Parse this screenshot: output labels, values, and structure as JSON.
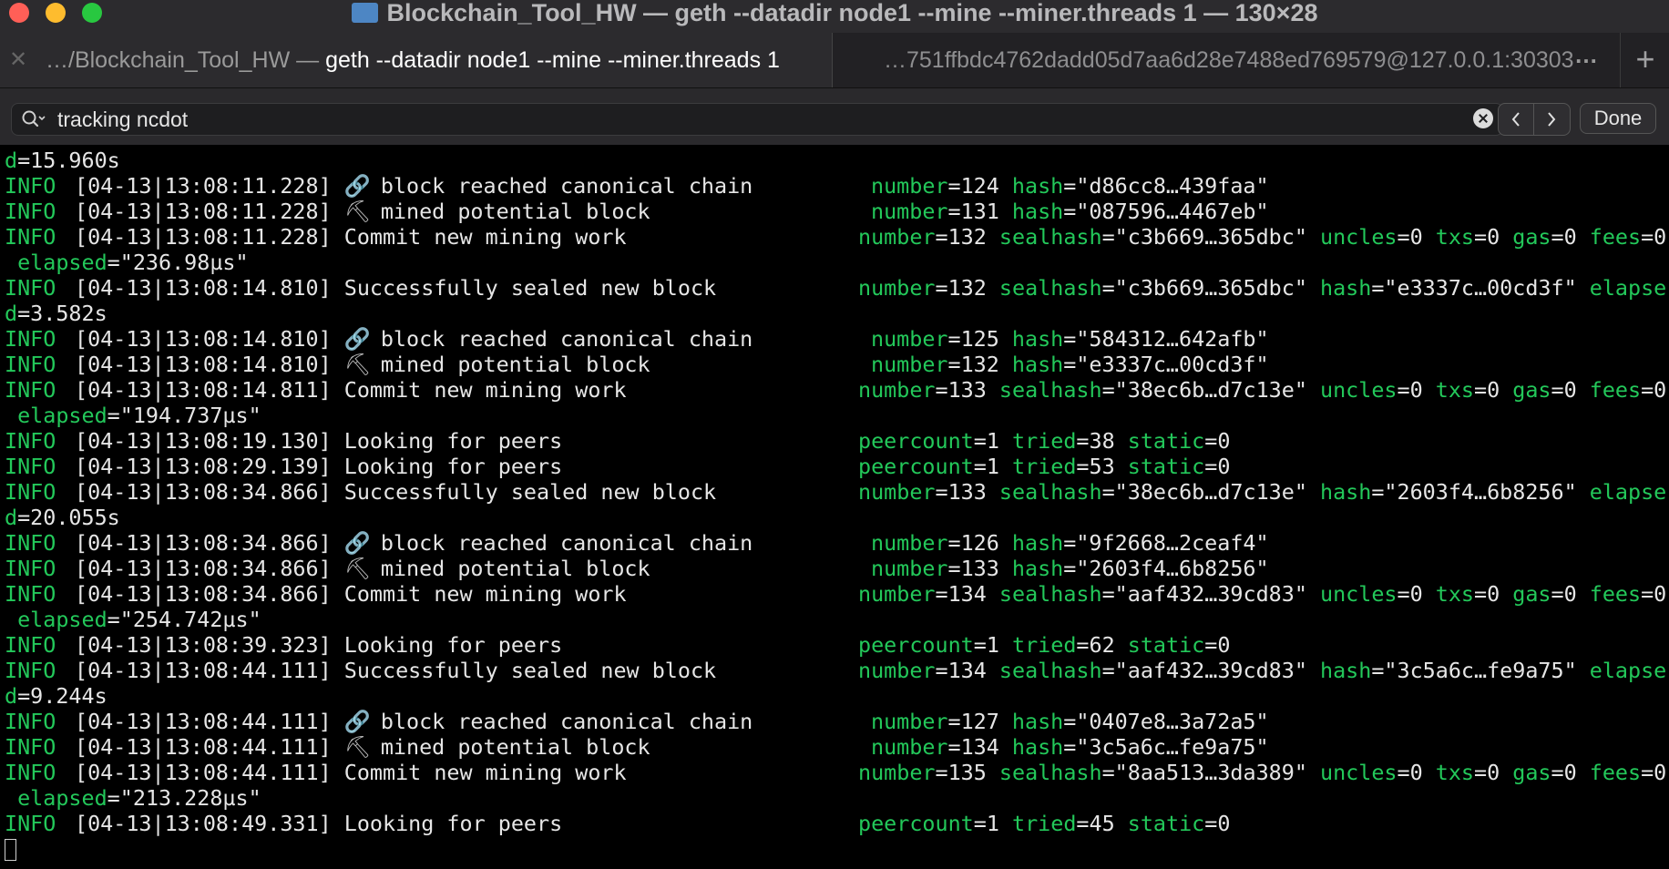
{
  "window": {
    "title": "Blockchain_Tool_HW — geth --datadir node1 --mine --miner.threads 1 — 130×28"
  },
  "tabs": [
    {
      "prefix": "…/Blockchain_Tool_HW — ",
      "label": "geth --datadir node1 --mine --miner.threads 1"
    },
    {
      "label": "…751ffbdc4762dadd05d7aa6d28e7488ed769579@127.0.0.1:30303"
    }
  ],
  "tab_more": "…",
  "tab_add": "+",
  "find": {
    "query": "tracking ncdot",
    "done_label": "Done"
  },
  "icons": {
    "chain": "🔗",
    "hammer": "⛏",
    "search": "search-icon",
    "clear": "clear-icon"
  },
  "log_lines": [
    {
      "type": "cont",
      "parts": [
        [
          "k",
          "d"
        ],
        [
          "t",
          "=15.960s"
        ]
      ]
    },
    {
      "type": "log",
      "level": "INFO",
      "time": "[04-13|13:08:11.228]",
      "icon": "chain",
      "message": "block reached canonical chain",
      "indent": true,
      "fields": [
        [
          "number",
          "=124 "
        ],
        [
          "hash",
          "=\"d86cc8…439faa\""
        ]
      ]
    },
    {
      "type": "log",
      "level": "INFO",
      "time": "[04-13|13:08:11.228]",
      "icon": "hammer",
      "message": "mined potential block",
      "indent": true,
      "fields": [
        [
          "number",
          "=131 "
        ],
        [
          "hash",
          "=\"087596…4467eb\""
        ]
      ]
    },
    {
      "type": "log",
      "level": "INFO",
      "time": "[04-13|13:08:11.228]",
      "message": "Commit new mining work",
      "fields": [
        [
          "number",
          "=132 "
        ],
        [
          "sealhash",
          "=\"c3b669…365dbc\" "
        ],
        [
          "uncles",
          "=0 "
        ],
        [
          "txs",
          "=0 "
        ],
        [
          "gas",
          "=0 "
        ],
        [
          "fees",
          "=0"
        ]
      ]
    },
    {
      "type": "cont",
      "parts": [
        [
          "t",
          " "
        ],
        [
          "k",
          "elapsed"
        ],
        [
          "t",
          "=\"236.98µs\""
        ]
      ]
    },
    {
      "type": "log",
      "level": "INFO",
      "time": "[04-13|13:08:14.810]",
      "message": "Successfully sealed new block",
      "fields": [
        [
          "number",
          "=132 "
        ],
        [
          "sealhash",
          "=\"c3b669…365dbc\" "
        ],
        [
          "hash",
          "=\"e3337c…00cd3f\" "
        ],
        [
          "elapse",
          ""
        ]
      ]
    },
    {
      "type": "cont",
      "parts": [
        [
          "k",
          "d"
        ],
        [
          "t",
          "=3.582s"
        ]
      ]
    },
    {
      "type": "log",
      "level": "INFO",
      "time": "[04-13|13:08:14.810]",
      "icon": "chain",
      "message": "block reached canonical chain",
      "indent": true,
      "fields": [
        [
          "number",
          "=125 "
        ],
        [
          "hash",
          "=\"584312…642afb\""
        ]
      ]
    },
    {
      "type": "log",
      "level": "INFO",
      "time": "[04-13|13:08:14.810]",
      "icon": "hammer",
      "message": "mined potential block",
      "indent": true,
      "fields": [
        [
          "number",
          "=132 "
        ],
        [
          "hash",
          "=\"e3337c…00cd3f\""
        ]
      ]
    },
    {
      "type": "log",
      "level": "INFO",
      "time": "[04-13|13:08:14.811]",
      "message": "Commit new mining work",
      "fields": [
        [
          "number",
          "=133 "
        ],
        [
          "sealhash",
          "=\"38ec6b…d7c13e\" "
        ],
        [
          "uncles",
          "=0 "
        ],
        [
          "txs",
          "=0 "
        ],
        [
          "gas",
          "=0 "
        ],
        [
          "fees",
          "=0"
        ]
      ]
    },
    {
      "type": "cont",
      "parts": [
        [
          "t",
          " "
        ],
        [
          "k",
          "elapsed"
        ],
        [
          "t",
          "=\"194.737µs\""
        ]
      ]
    },
    {
      "type": "log",
      "level": "INFO",
      "time": "[04-13|13:08:19.130]",
      "message": "Looking for peers",
      "fields": [
        [
          "peercount",
          "=1 "
        ],
        [
          "tried",
          "=38 "
        ],
        [
          "static",
          "=0"
        ]
      ]
    },
    {
      "type": "log",
      "level": "INFO",
      "time": "[04-13|13:08:29.139]",
      "message": "Looking for peers",
      "fields": [
        [
          "peercount",
          "=1 "
        ],
        [
          "tried",
          "=53 "
        ],
        [
          "static",
          "=0"
        ]
      ]
    },
    {
      "type": "log",
      "level": "INFO",
      "time": "[04-13|13:08:34.866]",
      "message": "Successfully sealed new block",
      "fields": [
        [
          "number",
          "=133 "
        ],
        [
          "sealhash",
          "=\"38ec6b…d7c13e\" "
        ],
        [
          "hash",
          "=\"2603f4…6b8256\" "
        ],
        [
          "elapse",
          ""
        ]
      ]
    },
    {
      "type": "cont",
      "parts": [
        [
          "k",
          "d"
        ],
        [
          "t",
          "=20.055s"
        ]
      ]
    },
    {
      "type": "log",
      "level": "INFO",
      "time": "[04-13|13:08:34.866]",
      "icon": "chain",
      "message": "block reached canonical chain",
      "indent": true,
      "fields": [
        [
          "number",
          "=126 "
        ],
        [
          "hash",
          "=\"9f2668…2ceaf4\""
        ]
      ]
    },
    {
      "type": "log",
      "level": "INFO",
      "time": "[04-13|13:08:34.866]",
      "icon": "hammer",
      "message": "mined potential block",
      "indent": true,
      "fields": [
        [
          "number",
          "=133 "
        ],
        [
          "hash",
          "=\"2603f4…6b8256\""
        ]
      ]
    },
    {
      "type": "log",
      "level": "INFO",
      "time": "[04-13|13:08:34.866]",
      "message": "Commit new mining work",
      "fields": [
        [
          "number",
          "=134 "
        ],
        [
          "sealhash",
          "=\"aaf432…39cd83\" "
        ],
        [
          "uncles",
          "=0 "
        ],
        [
          "txs",
          "=0 "
        ],
        [
          "gas",
          "=0 "
        ],
        [
          "fees",
          "=0"
        ]
      ]
    },
    {
      "type": "cont",
      "parts": [
        [
          "t",
          " "
        ],
        [
          "k",
          "elapsed"
        ],
        [
          "t",
          "=\"254.742µs\""
        ]
      ]
    },
    {
      "type": "log",
      "level": "INFO",
      "time": "[04-13|13:08:39.323]",
      "message": "Looking for peers",
      "fields": [
        [
          "peercount",
          "=1 "
        ],
        [
          "tried",
          "=62 "
        ],
        [
          "static",
          "=0"
        ]
      ]
    },
    {
      "type": "log",
      "level": "INFO",
      "time": "[04-13|13:08:44.111]",
      "message": "Successfully sealed new block",
      "fields": [
        [
          "number",
          "=134 "
        ],
        [
          "sealhash",
          "=\"aaf432…39cd83\" "
        ],
        [
          "hash",
          "=\"3c5a6c…fe9a75\" "
        ],
        [
          "elapse",
          ""
        ]
      ]
    },
    {
      "type": "cont",
      "parts": [
        [
          "k",
          "d"
        ],
        [
          "t",
          "=9.244s"
        ]
      ]
    },
    {
      "type": "log",
      "level": "INFO",
      "time": "[04-13|13:08:44.111]",
      "icon": "chain",
      "message": "block reached canonical chain",
      "indent": true,
      "fields": [
        [
          "number",
          "=127 "
        ],
        [
          "hash",
          "=\"0407e8…3a72a5\""
        ]
      ]
    },
    {
      "type": "log",
      "level": "INFO",
      "time": "[04-13|13:08:44.111]",
      "icon": "hammer",
      "message": "mined potential block",
      "indent": true,
      "fields": [
        [
          "number",
          "=134 "
        ],
        [
          "hash",
          "=\"3c5a6c…fe9a75\""
        ]
      ]
    },
    {
      "type": "log",
      "level": "INFO",
      "time": "[04-13|13:08:44.111]",
      "message": "Commit new mining work",
      "fields": [
        [
          "number",
          "=135 "
        ],
        [
          "sealhash",
          "=\"8aa513…3da389\" "
        ],
        [
          "uncles",
          "=0 "
        ],
        [
          "txs",
          "=0 "
        ],
        [
          "gas",
          "=0 "
        ],
        [
          "fees",
          "=0"
        ]
      ]
    },
    {
      "type": "cont",
      "parts": [
        [
          "t",
          " "
        ],
        [
          "k",
          "elapsed"
        ],
        [
          "t",
          "=\"213.228µs\""
        ]
      ]
    },
    {
      "type": "log",
      "level": "INFO",
      "time": "[04-13|13:08:49.331]",
      "message": "Looking for peers",
      "fields": [
        [
          "peercount",
          "=1 "
        ],
        [
          "tried",
          "=45 "
        ],
        [
          "static",
          "=0"
        ]
      ]
    }
  ],
  "colors": {
    "key_green": "#23c85a",
    "text": "#e6e6e6",
    "background": "#000000",
    "title_bar": "#2c2b2e"
  }
}
